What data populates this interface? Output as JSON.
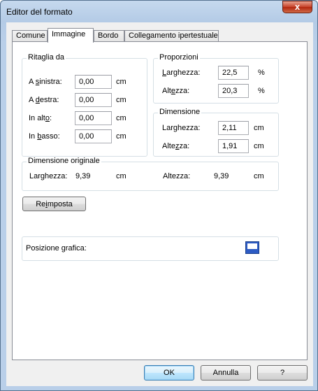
{
  "window": {
    "title": "Editor del formato",
    "close": "x"
  },
  "tabs": [
    {
      "label": "Comune"
    },
    {
      "label": "Immagine"
    },
    {
      "label": "Bordo"
    },
    {
      "label": "Collegamento ipertestuale"
    }
  ],
  "crop": {
    "title": "Ritaglia da",
    "left": {
      "pre": "A ",
      "key": "s",
      "post": "inistra:",
      "value": "0,00",
      "unit": "cm"
    },
    "right": {
      "pre": "A ",
      "key": "d",
      "post": "estra:",
      "value": "0,00",
      "unit": "cm"
    },
    "top": {
      "pre": "In alt",
      "key": "o",
      "post": ":",
      "value": "0,00",
      "unit": "cm"
    },
    "bottom": {
      "pre": "In ",
      "key": "b",
      "post": "asso:",
      "value": "0,00",
      "unit": "cm"
    }
  },
  "proportions": {
    "title": "Proporzioni",
    "width": {
      "pre": "",
      "key": "L",
      "post": "arghezza:",
      "value": "22,5",
      "unit": "%"
    },
    "height": {
      "pre": "Alt",
      "key": "e",
      "post": "zza:",
      "value": "20,3",
      "unit": "%"
    }
  },
  "dimension": {
    "title": "Dimensione",
    "width": {
      "pre": "Lar",
      "key": "g",
      "post": "hezza:",
      "value": "2,11",
      "unit": "cm"
    },
    "height": {
      "pre": "Alte",
      "key": "z",
      "post": "za:",
      "value": "1,91",
      "unit": "cm"
    }
  },
  "original": {
    "title": "Dimensione originale",
    "width_label": "Larghezza:",
    "width_value": "9,39",
    "width_unit": "cm",
    "height_label": "Altezza:",
    "height_value": "9,39",
    "height_unit": "cm"
  },
  "reset": {
    "pre": "Re",
    "key": "i",
    "post": "mposta"
  },
  "position": {
    "label": "Posizione grafica:",
    "icon": "graphic-position-icon"
  },
  "footer": {
    "ok": "OK",
    "cancel": "Annulla",
    "help": "?"
  },
  "colors": {
    "titlebar": "#b9cfe9",
    "close": "#c7432a",
    "panel": "#ffffff",
    "dialog": "#f0f0f0",
    "default_button": "#3c7fb1"
  }
}
